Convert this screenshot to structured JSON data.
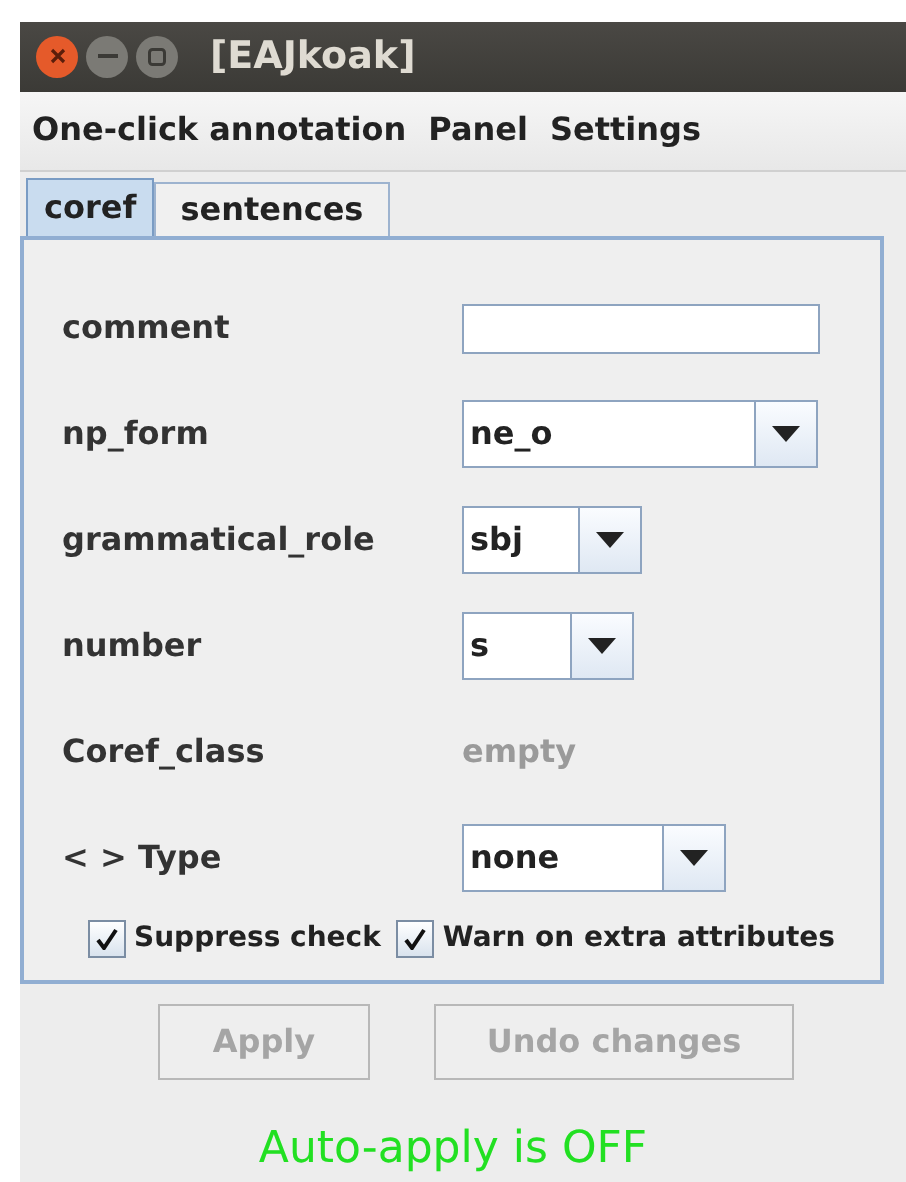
{
  "window": {
    "title": "[EAJkoak]"
  },
  "menu": [
    "One-click annotation",
    "Panel",
    "Settings"
  ],
  "tabs": [
    {
      "label": "coref",
      "selected": true
    },
    {
      "label": "sentences",
      "selected": false
    }
  ],
  "fields": [
    {
      "kind": "text",
      "label": "comment"
    },
    {
      "kind": "combo",
      "label": "np_form",
      "value": "ne_o"
    },
    {
      "kind": "combo",
      "label": "grammatical_role",
      "value": "sbj"
    },
    {
      "kind": "combo",
      "label": "number",
      "value": "s"
    },
    {
      "kind": "static",
      "label": "Coref_class",
      "value": "empty"
    },
    {
      "kind": "combo",
      "label": "< > Type",
      "value": "none"
    }
  ],
  "checkboxes": [
    {
      "label": "Suppress check",
      "checked": true
    },
    {
      "label": "Warn on extra attributes",
      "checked": true
    }
  ],
  "buttons": [
    {
      "label": "Apply",
      "disabled": true
    },
    {
      "label": "Undo changes",
      "disabled": true
    }
  ],
  "status": "Auto-apply is OFF"
}
